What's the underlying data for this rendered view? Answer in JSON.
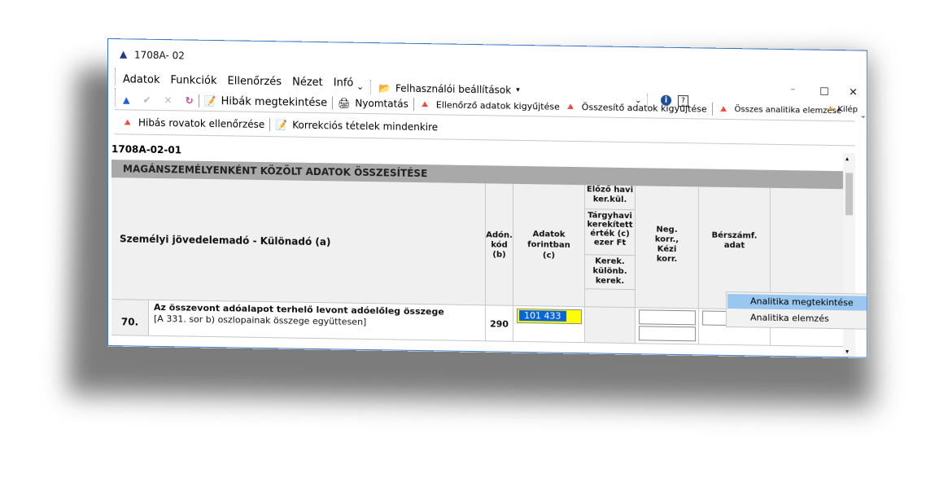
{
  "window": {
    "title": "1708A- 02",
    "title_icon": "app-triangle-icon",
    "controls": {
      "minimize": "–",
      "maximize": "☐",
      "close": "✕"
    }
  },
  "menu": {
    "items": [
      "Adatok",
      "Funkciók",
      "Ellenőrzés",
      "Nézet",
      "Infó"
    ],
    "more_glyph": "⌄",
    "settings": "Felhasználói beállítások",
    "settings_arrow": "▾",
    "settings_dropdown_glyph": "⌄",
    "info_glyph": "i",
    "help_glyph": "?"
  },
  "toolbar1": {
    "up": "▲",
    "check": "✔",
    "cancel": "✕",
    "refresh": "↻",
    "errors": "Hibák megtekintése",
    "print": "Nyomtatás",
    "collect_check": "Ellenőrző adatok kigyűjtése",
    "collect_summary": "Összesítő adatok kigyűjtése",
    "analytics_all": "Összes analitika elemzése",
    "exit": "Kilép",
    "exit_more": "⌄"
  },
  "toolbar2": {
    "bad_fields": "Hibás rovatok ellenőrzése",
    "corrections": "Korrekciós tételek mindenkire"
  },
  "form": {
    "id": "1708A-02-01",
    "section_title": "MAGÁNSZEMÉLYENKÉNT KÖZÖLT ADATOK ÖSSZESÍTÉSE",
    "scroll_up": "▴",
    "scroll_down": "▾",
    "header": {
      "main": "Személyi jövedelemadó - Különadó (a)",
      "code": [
        "Adón.",
        "kód",
        "(b)"
      ],
      "amount": [
        "Adatok",
        "forintban",
        "(c)"
      ],
      "prev": [
        "Előző havi",
        "ker.kül."
      ],
      "current": [
        "Tárgyhavi",
        "kerekített",
        "érték (c)",
        "ezer Ft"
      ],
      "rounding": [
        "Kerek.",
        "különb.",
        "kerek."
      ],
      "neg": [
        "Neg.",
        "korr.,",
        "Kézi",
        "korr."
      ],
      "payroll": [
        "Bérszámf.",
        "adat"
      ]
    },
    "row": {
      "num": "70.",
      "title": "Az összevont adóalapot terhelő levont adóelőleg összege",
      "sub": "[A 331. sor b) oszlopainak összege együttesen]",
      "code": "290",
      "value": "101 433"
    }
  },
  "context_menu": {
    "items": [
      "Analitika megtekintése",
      "Analitika elemzés"
    ]
  },
  "colors": {
    "highlight_field": "#ffff00",
    "selection": "#0a64d6",
    "menu_hover": "#99c7ef"
  }
}
